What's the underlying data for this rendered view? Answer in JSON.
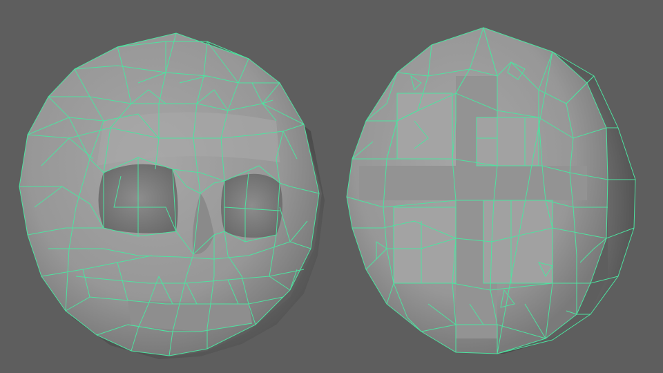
{
  "viewport": {
    "background_color": "#5e5e5e",
    "wireframe_color": "#4de3a0",
    "surface_color": "#9d9d9d"
  },
  "objects": [
    {
      "id": "skull-face-coin",
      "icon": "skull-face-mesh"
    },
    {
      "id": "cross-pattern-coin",
      "icon": "cross-panel-mesh"
    }
  ]
}
